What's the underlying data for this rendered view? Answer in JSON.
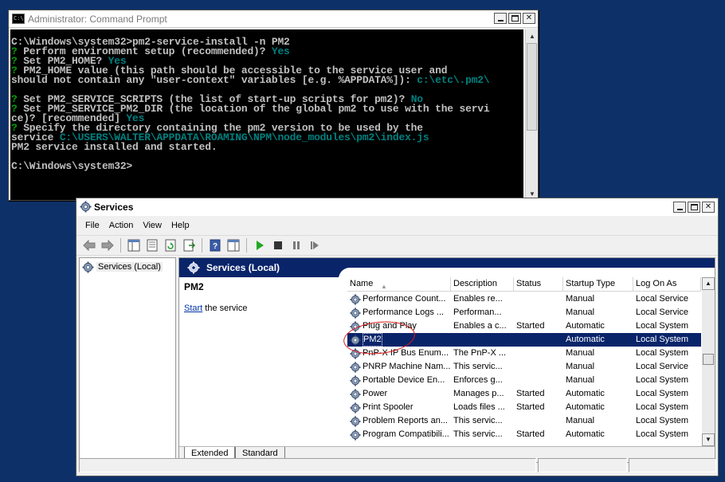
{
  "cmd": {
    "title": "Administrator: Command Prompt",
    "icon": "console-icon",
    "lines": [
      {
        "plain": "C:\\Windows\\system32>pm2-service-install -n PM2",
        "q": "",
        "ans": ""
      },
      {
        "plain": "",
        "q": "? ",
        "text": "Perform environment setup (recommended)? ",
        "ans": "Yes"
      },
      {
        "plain": "",
        "q": "? ",
        "text": "Set PM2_HOME? ",
        "ans": "Yes"
      },
      {
        "plain": "",
        "q": "? ",
        "text": "PM2_HOME value (this path should be accessible to the service user and",
        "ans": ""
      },
      {
        "plain": "should not contain any \"user-context\" variables [e.g. %APPDATA%]): ",
        "q": "",
        "ans": "c:\\etc\\.pm2\\"
      },
      {
        "plain": "",
        "q": "",
        "ans": ""
      },
      {
        "plain": "",
        "q": "? ",
        "text": "Set PM2_SERVICE_SCRIPTS (the list of start-up scripts for pm2)? ",
        "ans": "No"
      },
      {
        "plain": "",
        "q": "? ",
        "text": "Set PM2_SERVICE_PM2_DIR (the location of the global pm2 to use with the servi",
        "ans": ""
      },
      {
        "plain": "ce)? [recommended] ",
        "q": "",
        "ans": "Yes"
      },
      {
        "plain": "",
        "q": "? ",
        "text": "Specify the directory containing the pm2 version to be used by the",
        "ans": ""
      },
      {
        "plain": "service ",
        "q": "",
        "ans": "C:\\USERS\\WALTER\\APPDATA\\ROAMING\\NPM\\node_modules\\pm2\\index.js"
      },
      {
        "plain": "PM2 service installed and started.",
        "q": "",
        "ans": ""
      },
      {
        "plain": "",
        "q": "",
        "ans": ""
      },
      {
        "plain": "C:\\Windows\\system32>",
        "q": "",
        "ans": ""
      }
    ]
  },
  "services": {
    "title": "Services",
    "menu": [
      "File",
      "Action",
      "View",
      "Help"
    ],
    "toolbar_icons": [
      "back-arrow-icon",
      "forward-arrow-icon",
      "show-hide-console-tree-icon",
      "properties-icon",
      "refresh-icon",
      "export-list-icon",
      "help-icon",
      "show-hide-action-pane-icon",
      "start-service-icon",
      "stop-service-icon",
      "pause-service-icon",
      "restart-service-icon"
    ],
    "tree_label": "Services (Local)",
    "header_label": "Services (Local)",
    "detail": {
      "title": "PM2",
      "action_link": "Start",
      "action_rest": " the service"
    },
    "columns": {
      "name": "Name",
      "description": "Description",
      "status": "Status",
      "startup": "Startup Type",
      "logon": "Log On As"
    },
    "rows": [
      {
        "name": "Performance Count...",
        "description": "Enables re...",
        "status": "",
        "startup": "Manual",
        "logon": "Local Service"
      },
      {
        "name": "Performance Logs ...",
        "description": "Performan...",
        "status": "",
        "startup": "Manual",
        "logon": "Local Service"
      },
      {
        "name": "Plug and Play",
        "description": "Enables a c...",
        "status": "Started",
        "startup": "Automatic",
        "logon": "Local System"
      },
      {
        "name": "PM2",
        "description": "",
        "status": "",
        "startup": "Automatic",
        "logon": "Local System",
        "selected": true
      },
      {
        "name": "PnP-X IP Bus Enum...",
        "description": "The PnP-X ...",
        "status": "",
        "startup": "Manual",
        "logon": "Local System"
      },
      {
        "name": "PNRP Machine Nam...",
        "description": "This servic...",
        "status": "",
        "startup": "Manual",
        "logon": "Local Service"
      },
      {
        "name": "Portable Device En...",
        "description": "Enforces g...",
        "status": "",
        "startup": "Manual",
        "logon": "Local System"
      },
      {
        "name": "Power",
        "description": "Manages p...",
        "status": "Started",
        "startup": "Automatic",
        "logon": "Local System"
      },
      {
        "name": "Print Spooler",
        "description": "Loads files ...",
        "status": "Started",
        "startup": "Automatic",
        "logon": "Local System"
      },
      {
        "name": "Problem Reports an...",
        "description": "This servic...",
        "status": "",
        "startup": "Manual",
        "logon": "Local System"
      },
      {
        "name": "Program Compatibili...",
        "description": "This servic...",
        "status": "Started",
        "startup": "Automatic",
        "logon": "Local System"
      }
    ],
    "tabs": [
      "Extended",
      "Standard"
    ],
    "colors": {
      "selection": "#0a246a",
      "header_band": "#0a246a",
      "annotation": "#e01818",
      "console_answer": "#008080",
      "console_prompt": "#00a000"
    }
  }
}
